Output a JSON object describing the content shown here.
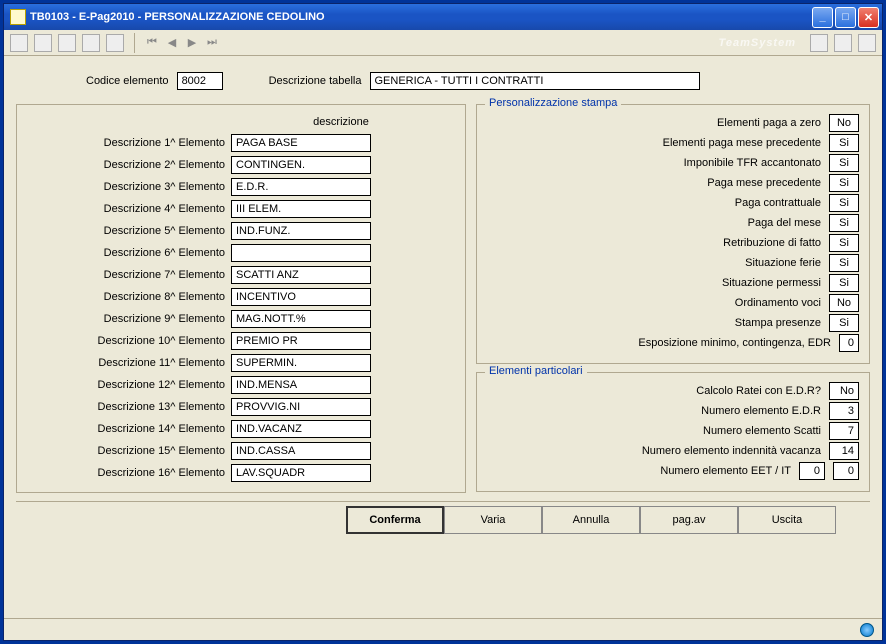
{
  "window": {
    "title": "TB0103  - E-Pag2010  -   PERSONALIZZAZIONE CEDOLINO"
  },
  "top": {
    "codice_label": "Codice elemento",
    "codice_value": "8002",
    "desc_tab_label": "Descrizione tabella",
    "desc_tab_value": "GENERICA - TUTTI I CONTRATTI"
  },
  "desc_header": "descrizione",
  "descrizioni": [
    {
      "label": "Descrizione  1^ Elemento",
      "value": "PAGA BASE"
    },
    {
      "label": "Descrizione  2^ Elemento",
      "value": "CONTINGEN."
    },
    {
      "label": "Descrizione  3^ Elemento",
      "value": "E.D.R."
    },
    {
      "label": "Descrizione  4^ Elemento",
      "value": "III ELEM."
    },
    {
      "label": "Descrizione  5^ Elemento",
      "value": "IND.FUNZ."
    },
    {
      "label": "Descrizione  6^ Elemento",
      "value": ""
    },
    {
      "label": "Descrizione  7^ Elemento",
      "value": "SCATTI ANZ"
    },
    {
      "label": "Descrizione  8^ Elemento",
      "value": "INCENTIVO"
    },
    {
      "label": "Descrizione  9^ Elemento",
      "value": "MAG.NOTT.%"
    },
    {
      "label": "Descrizione 10^ Elemento",
      "value": "PREMIO PR"
    },
    {
      "label": "Descrizione 11^ Elemento",
      "value": "SUPERMIN."
    },
    {
      "label": "Descrizione 12^ Elemento",
      "value": "IND.MENSA"
    },
    {
      "label": "Descrizione 13^ Elemento",
      "value": "PROVVIG.NI"
    },
    {
      "label": "Descrizione 14^ Elemento",
      "value": "IND.VACANZ"
    },
    {
      "label": "Descrizione 15^ Elemento",
      "value": "IND.CASSA"
    },
    {
      "label": "Descrizione 16^ Elemento",
      "value": "LAV.SQUADR"
    }
  ],
  "pers_stampa": {
    "legend": "Personalizzazione stampa",
    "rows": [
      {
        "label": "Elementi paga a zero",
        "value": "No"
      },
      {
        "label": "Elementi paga mese precedente",
        "value": "Si"
      },
      {
        "label": "Imponibile TFR accantonato",
        "value": "Si"
      },
      {
        "label": "Paga mese precedente",
        "value": "Si"
      },
      {
        "label": "Paga contrattuale",
        "value": "Si"
      },
      {
        "label": "Paga del mese",
        "value": "Si"
      },
      {
        "label": "Retribuzione di fatto",
        "value": "Si"
      },
      {
        "label": "Situazione ferie",
        "value": "Si"
      },
      {
        "label": "Situazione permessi",
        "value": "Si"
      },
      {
        "label": "Ordinamento voci",
        "value": "No"
      },
      {
        "label": "Stampa presenze",
        "value": "Si"
      },
      {
        "label": "Esposizione minimo, contingenza, EDR",
        "value": "0"
      }
    ]
  },
  "elem_part": {
    "legend": "Elementi particolari",
    "rows": [
      {
        "label": "Calcolo Ratei con E.D.R?",
        "value": "No"
      },
      {
        "label": "Numero elemento E.D.R",
        "value": "3"
      },
      {
        "label": "Numero elemento Scatti",
        "value": "7"
      },
      {
        "label": "Numero elemento indennità vacanza",
        "value": "14"
      }
    ],
    "eet": {
      "label": "Numero elemento EET / IT",
      "v1": "0",
      "v2": "0"
    }
  },
  "buttons": {
    "conferma": "Conferma",
    "varia": "Varia",
    "annulla": "Annulla",
    "pagav": "pag.av",
    "uscita": "Uscita"
  }
}
